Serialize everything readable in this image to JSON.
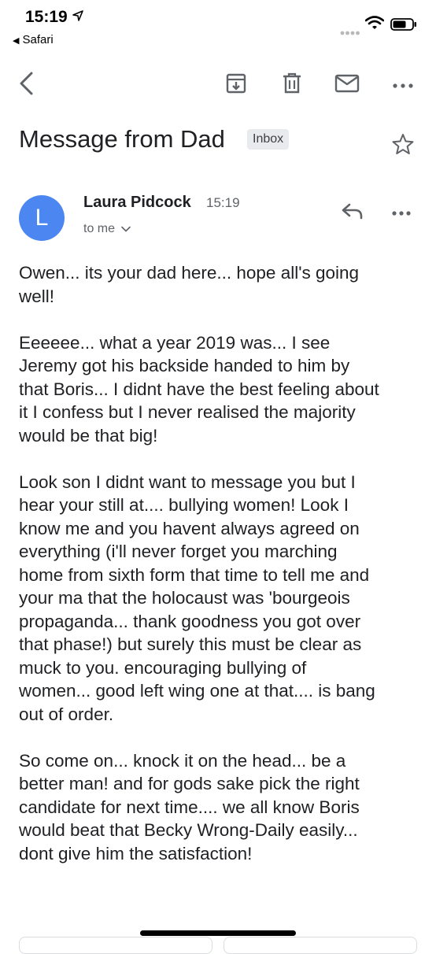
{
  "status_bar": {
    "time": "15:19",
    "back_app_label": "Safari"
  },
  "toolbar": {
    "back_icon": "chevron-left-icon",
    "archive_icon": "archive-icon",
    "delete_icon": "trash-icon",
    "mark_unread_icon": "mail-icon",
    "more_icon": "more-horizontal-icon"
  },
  "message": {
    "subject": "Message from Dad",
    "label": "Inbox",
    "sender": {
      "initial": "L",
      "name": "Laura Pidcock",
      "time": "15:19",
      "recipient": "to me",
      "avatar_color": "#4c86f0"
    },
    "paragraphs": [
      [
        "Owen... its your dad here... hope all's going",
        "well!"
      ],
      [
        "Eeeeee... what a year 2019 was... I see",
        "Jeremy got his backside handed to him by",
        "that Boris... I didnt have the best feeling about",
        "it I confess but I never realised the majority",
        "would be that big!"
      ],
      [
        "Look son I didnt want to message you but I",
        "hear your still at.... bullying women! Look I",
        "know  me and you havent always agreed on",
        "everything (i'll never forget you marching",
        "home from sixth form that time to tell me and",
        "your ma that the holocaust was 'bourgeois",
        "propaganda... thank goodness you got over",
        "that phase!) but surely this must be clear as",
        "muck to you. encouraging bullying of",
        "women... good left wing one at that.... is bang",
        "out of order."
      ],
      [
        "So come on... knock it on the head... be a",
        "better man! and for gods sake pick the right",
        "candidate for next time....  we all know Boris",
        "would beat that Becky Wrong-Daily easily...",
        "dont give him the satisfaction!"
      ]
    ]
  }
}
